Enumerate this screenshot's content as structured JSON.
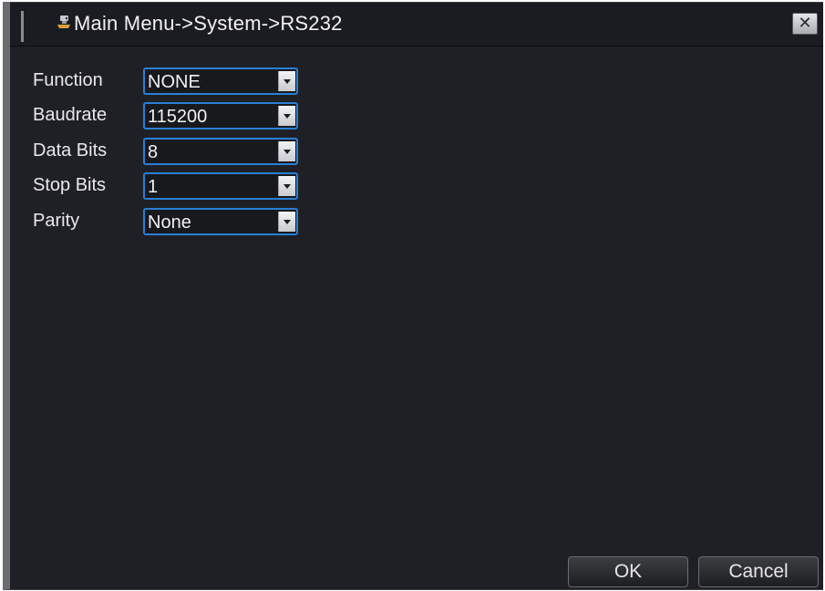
{
  "window": {
    "title": "Main Menu->System->RS232",
    "close_label": "✕"
  },
  "fields": [
    {
      "label": "Function",
      "value": "NONE"
    },
    {
      "label": "Baudrate",
      "value": "115200"
    },
    {
      "label": "Data Bits",
      "value": "8"
    },
    {
      "label": "Stop Bits",
      "value": "1"
    },
    {
      "label": "Parity",
      "value": "None"
    }
  ],
  "buttons": {
    "ok_label": "OK",
    "cancel_label": "Cancel"
  },
  "colors": {
    "background": "#1f2026",
    "select_border": "#2a7fd4",
    "text": "#e9e9ec"
  },
  "icons": {
    "title_icon": "system-settings-icon",
    "close_icon": "close-icon",
    "dropdown_icon": "chevron-down-icon"
  }
}
